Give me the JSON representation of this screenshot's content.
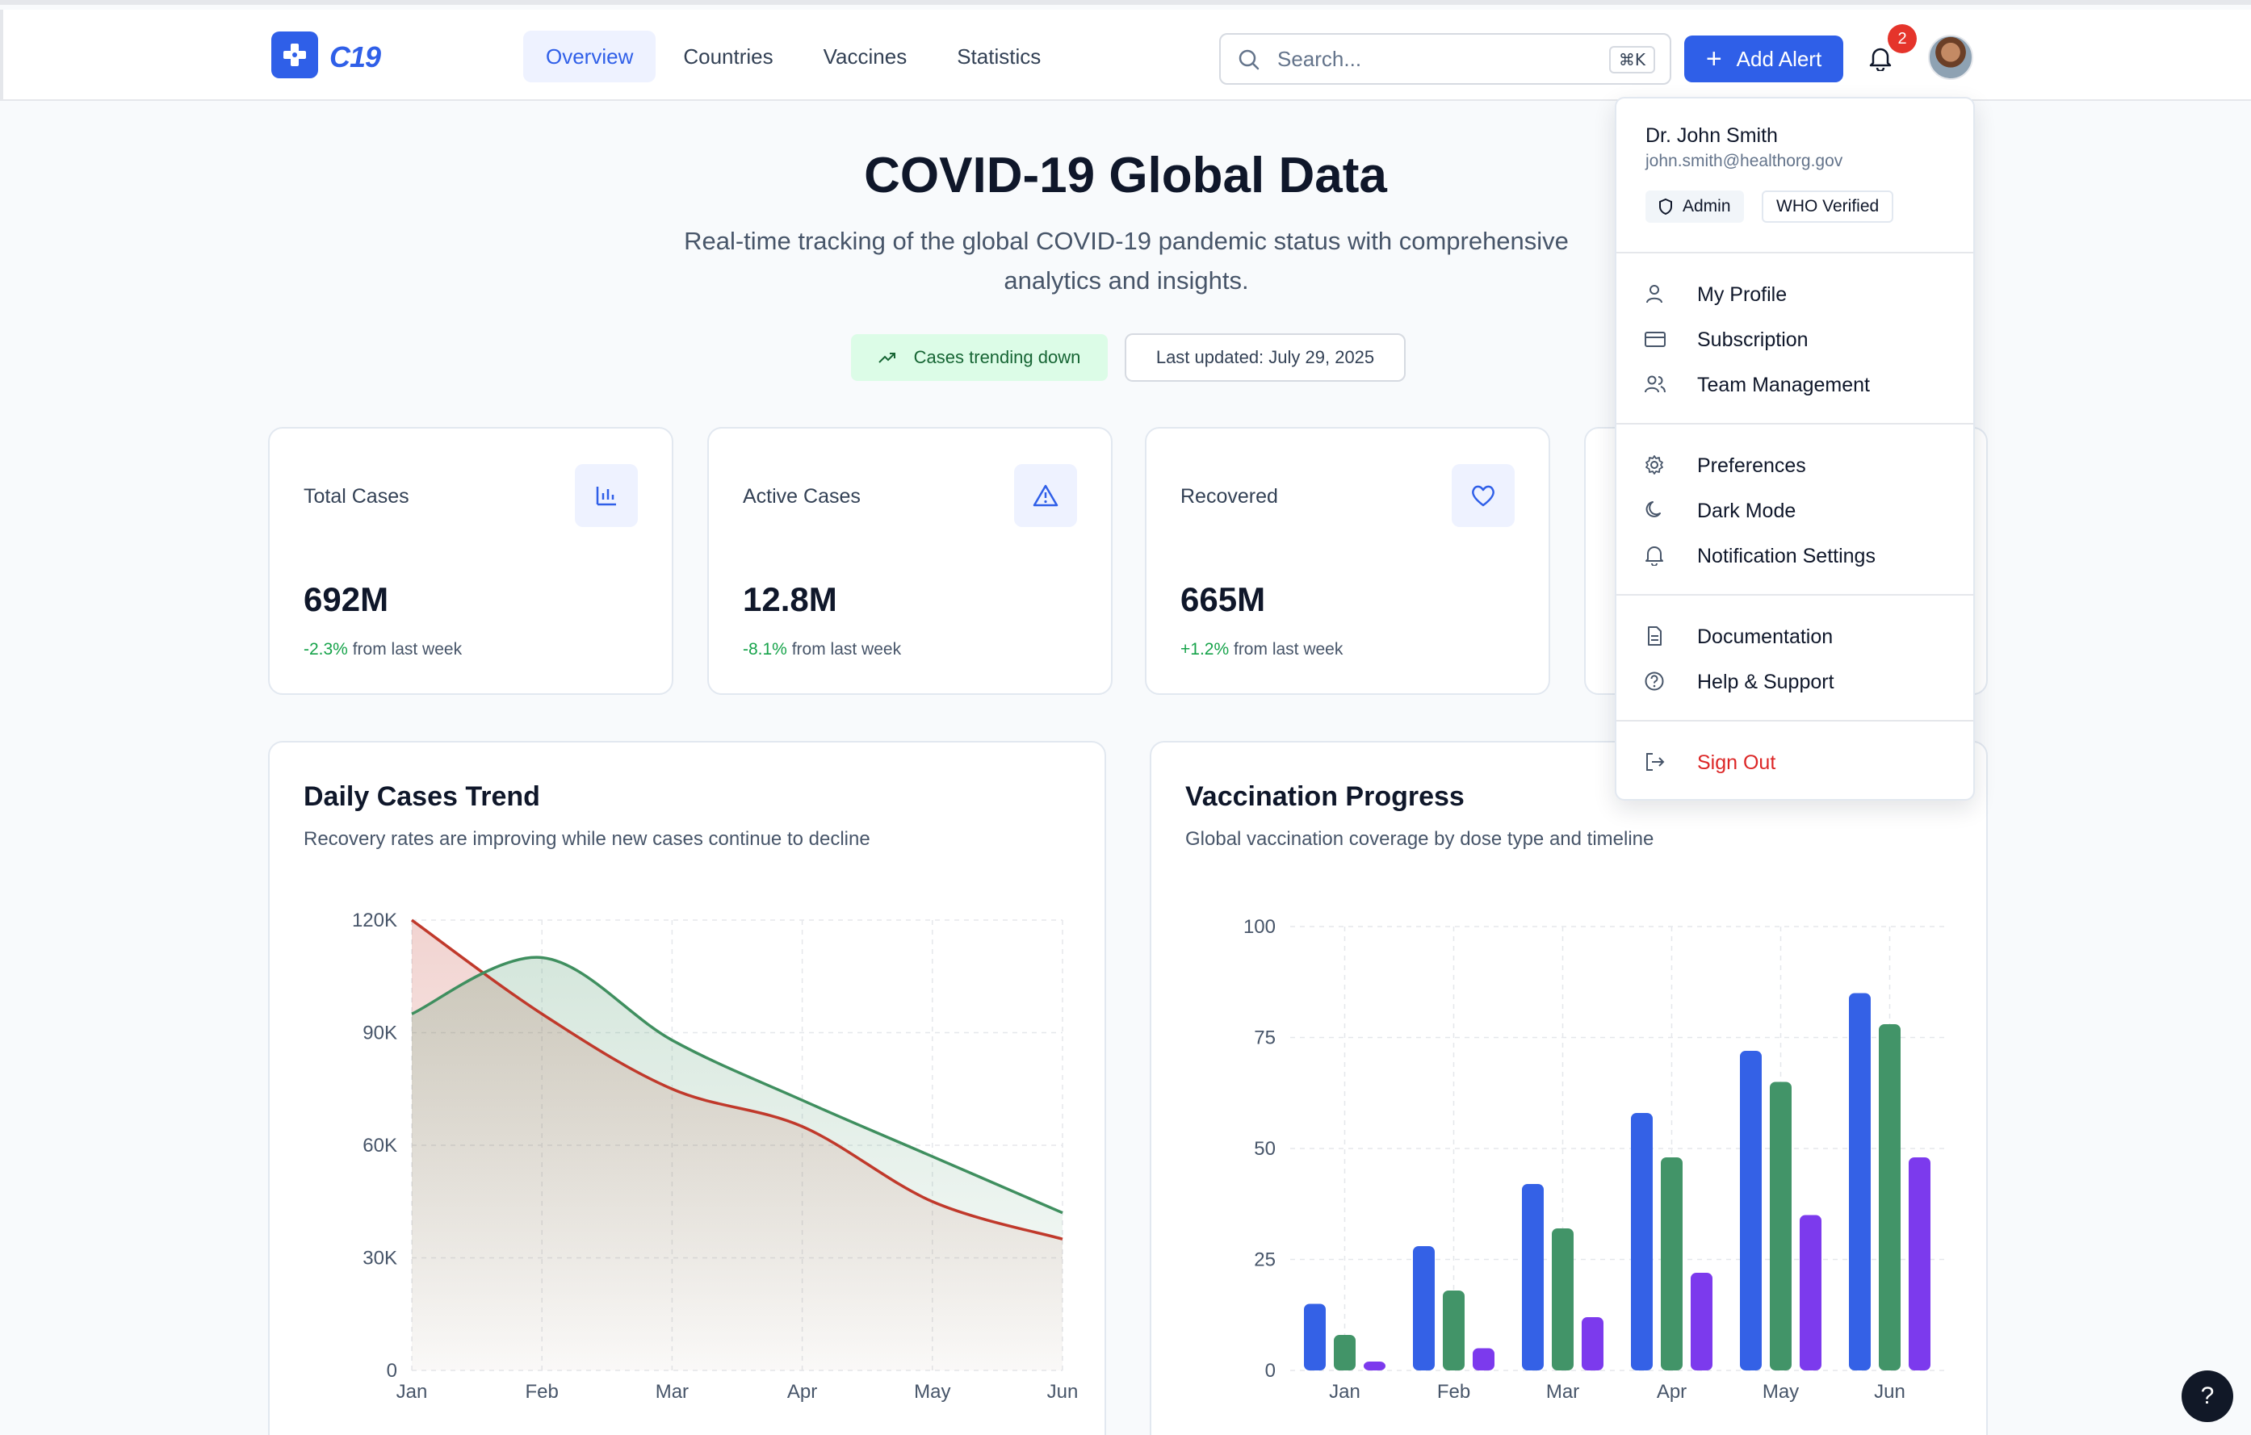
{
  "brand": {
    "name": "C19",
    "accent": "#2f5fe8"
  },
  "nav": [
    {
      "label": "Overview",
      "active": true
    },
    {
      "label": "Countries",
      "active": false
    },
    {
      "label": "Vaccines",
      "active": false
    },
    {
      "label": "Statistics",
      "active": false
    }
  ],
  "search": {
    "placeholder": "Search...",
    "shortcut": "⌘K"
  },
  "header": {
    "add_alert_label": "Add Alert",
    "notification_count": "2"
  },
  "hero": {
    "title": "COVID-19 Global Data",
    "subtitle": "Real-time tracking of the global COVID-19 pandemic status with comprehensive analytics and insights.",
    "trend_pill": "Cases trending down",
    "updated_pill": "Last updated: July 29, 2025"
  },
  "stats": [
    {
      "label": "Total Cases",
      "value": "692M",
      "delta": "-2.3%",
      "delta_suffix": "from last week",
      "icon": "bar-chart-icon"
    },
    {
      "label": "Active Cases",
      "value": "12.8M",
      "delta": "-8.1%",
      "delta_suffix": "from last week",
      "icon": "warning-triangle-icon"
    },
    {
      "label": "Recovered",
      "value": "665M",
      "delta": "+1.2%",
      "delta_suffix": "from last week",
      "icon": "heart-icon"
    }
  ],
  "charts": {
    "daily": {
      "title": "Daily Cases Trend",
      "subtitle": "Recovery rates are improving while new cases continue to decline"
    },
    "vaccination": {
      "title": "Vaccination Progress",
      "subtitle": "Global vaccination coverage by dose type and timeline"
    }
  },
  "chart_data": [
    {
      "type": "area",
      "title": "Daily Cases Trend",
      "categories": [
        "Jan",
        "Feb",
        "Mar",
        "Apr",
        "May",
        "Jun"
      ],
      "y_ticks": [
        "0",
        "30K",
        "60K",
        "90K",
        "120K"
      ],
      "ylim": [
        0,
        120000
      ],
      "grid": true,
      "series": [
        {
          "color": "#c0392b",
          "values": [
            120000,
            95000,
            75000,
            65000,
            45000,
            35000
          ]
        },
        {
          "color": "#3f8f5f",
          "values": [
            95000,
            110000,
            88000,
            72000,
            57000,
            42000
          ]
        }
      ]
    },
    {
      "type": "bar",
      "title": "Vaccination Progress",
      "categories": [
        "Jan",
        "Feb",
        "Mar",
        "Apr",
        "May",
        "Jun"
      ],
      "y_ticks": [
        "0",
        "25",
        "50",
        "75",
        "100"
      ],
      "ylim": [
        0,
        100
      ],
      "grid": true,
      "series": [
        {
          "color": "#3461e6",
          "values": [
            15,
            28,
            42,
            58,
            72,
            85
          ]
        },
        {
          "color": "#429468",
          "values": [
            8,
            18,
            32,
            48,
            65,
            78
          ]
        },
        {
          "color": "#7c3aed",
          "values": [
            2,
            5,
            12,
            22,
            35,
            48
          ]
        }
      ]
    }
  ],
  "user_menu": {
    "name": "Dr. John Smith",
    "email": "john.smith@healthorg.gov",
    "tags": [
      "Admin",
      "WHO Verified"
    ],
    "items": [
      {
        "label": "My Profile",
        "icon": "user-icon"
      },
      {
        "label": "Subscription",
        "icon": "credit-card-icon"
      },
      {
        "label": "Team Management",
        "icon": "users-icon"
      },
      {
        "label": "Preferences",
        "icon": "gear-icon"
      },
      {
        "label": "Dark Mode",
        "icon": "moon-icon"
      },
      {
        "label": "Notification Settings",
        "icon": "bell-icon"
      },
      {
        "label": "Documentation",
        "icon": "document-icon"
      },
      {
        "label": "Help & Support",
        "icon": "help-circle-icon"
      },
      {
        "label": "Sign Out",
        "icon": "logout-icon"
      }
    ]
  },
  "help_button": "?"
}
